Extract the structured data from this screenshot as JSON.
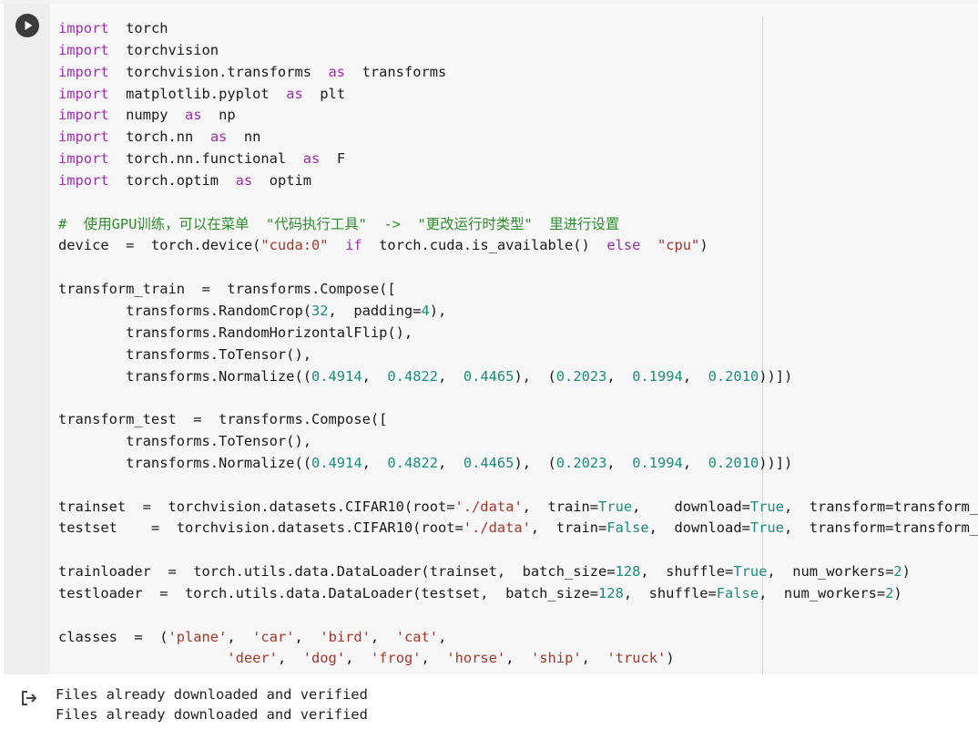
{
  "colors": {
    "keyword": "#9b2fae",
    "number": "#1c8d7d",
    "string": "#a3372b",
    "comment": "#2e8b2e",
    "text": "#1a1a1a",
    "code_background": "#f7f7f7",
    "gutter_background": "#eeeeee"
  },
  "cell": {
    "run_button_icon": "play-icon",
    "code_lines": [
      [
        {
          "t": "import",
          "c": "kw"
        },
        {
          "t": "  torch"
        }
      ],
      [
        {
          "t": "import",
          "c": "kw"
        },
        {
          "t": "  torchvision"
        }
      ],
      [
        {
          "t": "import",
          "c": "kw"
        },
        {
          "t": "  torchvision.transforms  "
        },
        {
          "t": "as",
          "c": "kw"
        },
        {
          "t": "  transforms"
        }
      ],
      [
        {
          "t": "import",
          "c": "kw"
        },
        {
          "t": "  matplotlib.pyplot  "
        },
        {
          "t": "as",
          "c": "kw"
        },
        {
          "t": "  plt"
        }
      ],
      [
        {
          "t": "import",
          "c": "kw"
        },
        {
          "t": "  numpy  "
        },
        {
          "t": "as",
          "c": "kw"
        },
        {
          "t": "  np"
        }
      ],
      [
        {
          "t": "import",
          "c": "kw"
        },
        {
          "t": "  torch.nn  "
        },
        {
          "t": "as",
          "c": "kw"
        },
        {
          "t": "  nn"
        }
      ],
      [
        {
          "t": "import",
          "c": "kw"
        },
        {
          "t": "  torch.nn.functional  "
        },
        {
          "t": "as",
          "c": "kw"
        },
        {
          "t": "  F"
        }
      ],
      [
        {
          "t": "import",
          "c": "kw"
        },
        {
          "t": "  torch.optim  "
        },
        {
          "t": "as",
          "c": "kw"
        },
        {
          "t": "  optim"
        }
      ],
      [],
      [
        {
          "t": "#  使用GPU训练，可以在菜单  \"代码执行工具\"  ->  \"更改运行时类型\"  里进行设置",
          "c": "cmt"
        }
      ],
      [
        {
          "t": "device  =  torch.device("
        },
        {
          "t": "\"cuda:0\"",
          "c": "str"
        },
        {
          "t": "  "
        },
        {
          "t": "if",
          "c": "kw"
        },
        {
          "t": "  torch.cuda.is_available()  "
        },
        {
          "t": "else",
          "c": "kw"
        },
        {
          "t": "  "
        },
        {
          "t": "\"cpu\"",
          "c": "str"
        },
        {
          "t": ")"
        }
      ],
      [],
      [
        {
          "t": "transform_train  =  transforms.Compose(["
        }
      ],
      [
        {
          "t": "        transforms.RandomCrop("
        },
        {
          "t": "32",
          "c": "num"
        },
        {
          "t": ",  padding="
        },
        {
          "t": "4",
          "c": "num"
        },
        {
          "t": "),"
        }
      ],
      [
        {
          "t": "        transforms.RandomHorizontalFlip(),"
        }
      ],
      [
        {
          "t": "        transforms.ToTensor(),"
        }
      ],
      [
        {
          "t": "        transforms.Normalize(("
        },
        {
          "t": "0.4914",
          "c": "num"
        },
        {
          "t": ",  "
        },
        {
          "t": "0.4822",
          "c": "num"
        },
        {
          "t": ",  "
        },
        {
          "t": "0.4465",
          "c": "num"
        },
        {
          "t": "),  ("
        },
        {
          "t": "0.2023",
          "c": "num"
        },
        {
          "t": ",  "
        },
        {
          "t": "0.1994",
          "c": "num"
        },
        {
          "t": ",  "
        },
        {
          "t": "0.2010",
          "c": "num"
        },
        {
          "t": "))])"
        }
      ],
      [],
      [
        {
          "t": "transform_test  =  transforms.Compose(["
        }
      ],
      [
        {
          "t": "        transforms.ToTensor(),"
        }
      ],
      [
        {
          "t": "        transforms.Normalize(("
        },
        {
          "t": "0.4914",
          "c": "num"
        },
        {
          "t": ",  "
        },
        {
          "t": "0.4822",
          "c": "num"
        },
        {
          "t": ",  "
        },
        {
          "t": "0.4465",
          "c": "num"
        },
        {
          "t": "),  ("
        },
        {
          "t": "0.2023",
          "c": "num"
        },
        {
          "t": ",  "
        },
        {
          "t": "0.1994",
          "c": "num"
        },
        {
          "t": ",  "
        },
        {
          "t": "0.2010",
          "c": "num"
        },
        {
          "t": "))])"
        }
      ],
      [],
      [
        {
          "t": "trainset  =  torchvision.datasets.CIFAR10(root="
        },
        {
          "t": "'./data'",
          "c": "str"
        },
        {
          "t": ",  train="
        },
        {
          "t": "True",
          "c": "num"
        },
        {
          "t": ",    download="
        },
        {
          "t": "True",
          "c": "num"
        },
        {
          "t": ",  transform=transform_train)"
        }
      ],
      [
        {
          "t": "testset    =  torchvision.datasets.CIFAR10(root="
        },
        {
          "t": "'./data'",
          "c": "str"
        },
        {
          "t": ",  train="
        },
        {
          "t": "False",
          "c": "num"
        },
        {
          "t": ",  download="
        },
        {
          "t": "True",
          "c": "num"
        },
        {
          "t": ",  transform=transform_test)"
        }
      ],
      [],
      [
        {
          "t": "trainloader  =  torch.utils.data.DataLoader(trainset,  batch_size="
        },
        {
          "t": "128",
          "c": "num"
        },
        {
          "t": ",  shuffle="
        },
        {
          "t": "True",
          "c": "num"
        },
        {
          "t": ",  num_workers="
        },
        {
          "t": "2",
          "c": "num"
        },
        {
          "t": ")"
        }
      ],
      [
        {
          "t": "testloader  =  torch.utils.data.DataLoader(testset,  batch_size="
        },
        {
          "t": "128",
          "c": "num"
        },
        {
          "t": ",  shuffle="
        },
        {
          "t": "False",
          "c": "num"
        },
        {
          "t": ",  num_workers="
        },
        {
          "t": "2",
          "c": "num"
        },
        {
          "t": ")"
        }
      ],
      [],
      [
        {
          "t": "classes  =  ("
        },
        {
          "t": "'plane'",
          "c": "str"
        },
        {
          "t": ",  "
        },
        {
          "t": "'car'",
          "c": "str"
        },
        {
          "t": ",  "
        },
        {
          "t": "'bird'",
          "c": "str"
        },
        {
          "t": ",  "
        },
        {
          "t": "'cat'",
          "c": "str"
        },
        {
          "t": ","
        }
      ],
      [
        {
          "t": "                    "
        },
        {
          "t": "'deer'",
          "c": "str"
        },
        {
          "t": ",  "
        },
        {
          "t": "'dog'",
          "c": "str"
        },
        {
          "t": ",  "
        },
        {
          "t": "'frog'",
          "c": "str"
        },
        {
          "t": ",  "
        },
        {
          "t": "'horse'",
          "c": "str"
        },
        {
          "t": ",  "
        },
        {
          "t": "'ship'",
          "c": "str"
        },
        {
          "t": ",  "
        },
        {
          "t": "'truck'",
          "c": "str"
        },
        {
          "t": ")"
        }
      ]
    ]
  },
  "output": {
    "icon": "output-arrow-icon",
    "lines": [
      "Files already downloaded and verified",
      "Files already downloaded and verified"
    ]
  }
}
